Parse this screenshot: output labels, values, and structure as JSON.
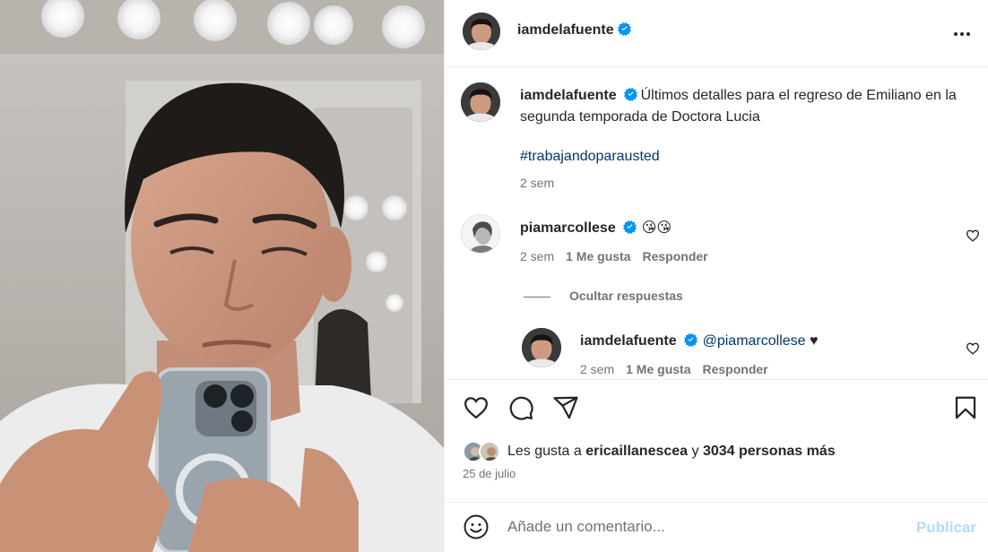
{
  "post": {
    "author": "iamdelafuente",
    "caption": "Últimos detalles para el regreso de Emiliano en la segunda temporada de Doctora Lucia",
    "hashtag": "#trabajandoparausted",
    "time": "2 sem"
  },
  "comments": [
    {
      "user": "piamarcollese",
      "text": "😘😘",
      "time": "2 sem",
      "likes": "1 Me gusta",
      "reply_label": "Responder"
    }
  ],
  "hide_replies": "Ocultar respuestas",
  "reply": {
    "user": "iamdelafuente",
    "mention": "@piamarcollese",
    "text": "♥",
    "time": "2 sem",
    "likes": "1 Me gusta",
    "reply_label": "Responder"
  },
  "likes": {
    "prefix": "Les gusta a",
    "user": "ericaillanescea",
    "connector": "y",
    "others": "3034 personas más"
  },
  "date": "25 de julio",
  "comment_box": {
    "placeholder": "Añade un comentario...",
    "publish": "Publicar"
  },
  "colors": {
    "verified": "#0095f6",
    "link": "#00376b",
    "muted": "#737373",
    "publish_disabled": "#b3dbff"
  },
  "icons": [
    "more-icon",
    "verified-icon",
    "heart-icon",
    "comment-icon",
    "share-icon",
    "bookmark-icon",
    "emoji-icon"
  ]
}
